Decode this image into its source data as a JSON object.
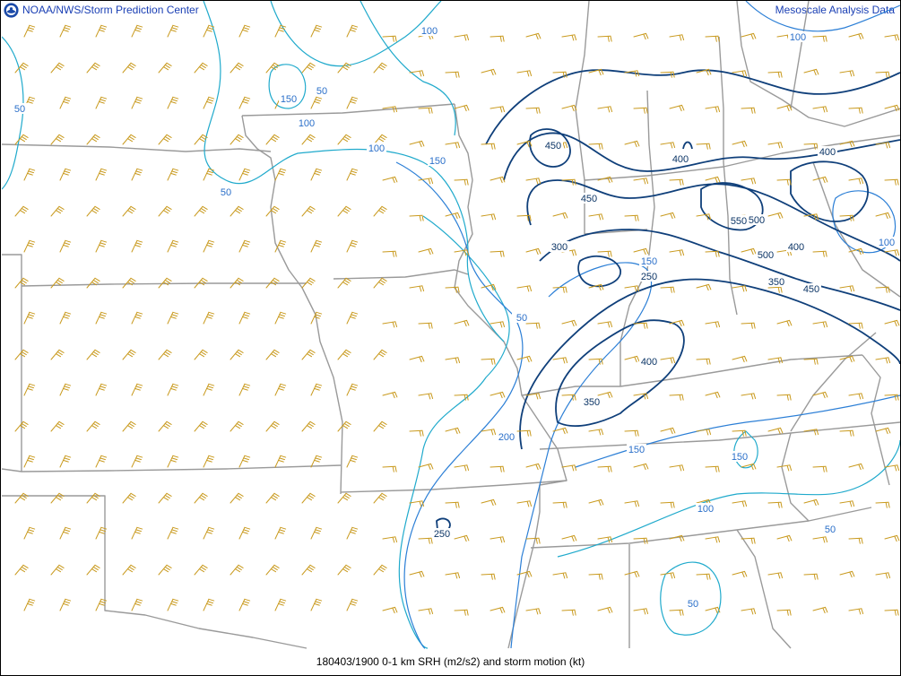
{
  "header": {
    "agency": "NOAA/NWS/Storm Prediction Center",
    "product": "Mesoscale Analysis Data"
  },
  "footer": {
    "caption": "180403/1900 0-1 km SRH (m2/s2) and storm motion (kt)"
  },
  "colors": {
    "boundary": "#9a9a9a",
    "barb": "#c99a1e",
    "contour_low": "#20aacc",
    "contour_mid": "#2c7fd6",
    "contour_high": "#0f3f7a",
    "label_text": "#2a6fc9",
    "label_dark": "#0c3566"
  },
  "contour_labels": [
    {
      "text": "100",
      "level": "low"
    },
    {
      "text": "50",
      "level": "low"
    },
    {
      "text": "150",
      "level": "low"
    },
    {
      "text": "50",
      "level": "low"
    },
    {
      "text": "100",
      "level": "low"
    },
    {
      "text": "50",
      "level": "low"
    },
    {
      "text": "100",
      "level": "low"
    },
    {
      "text": "150",
      "level": "mid"
    },
    {
      "text": "50",
      "level": "low"
    },
    {
      "text": "150",
      "level": "mid"
    },
    {
      "text": "250",
      "level": "dark"
    },
    {
      "text": "300",
      "level": "dark"
    },
    {
      "text": "450",
      "level": "dark"
    },
    {
      "text": "450",
      "level": "dark"
    },
    {
      "text": "400",
      "level": "dark"
    },
    {
      "text": "550",
      "level": "dark"
    },
    {
      "text": "500",
      "level": "dark"
    },
    {
      "text": "500",
      "level": "dark"
    },
    {
      "text": "350",
      "level": "dark"
    },
    {
      "text": "450",
      "level": "dark"
    },
    {
      "text": "400",
      "level": "dark"
    },
    {
      "text": "400",
      "level": "dark"
    },
    {
      "text": "100",
      "level": "low"
    },
    {
      "text": "100",
      "level": "low"
    },
    {
      "text": "400",
      "level": "dark"
    },
    {
      "text": "350",
      "level": "dark"
    },
    {
      "text": "200",
      "level": "mid"
    },
    {
      "text": "150",
      "level": "mid"
    },
    {
      "text": "150",
      "level": "low"
    },
    {
      "text": "100",
      "level": "low"
    },
    {
      "text": "50",
      "level": "low"
    },
    {
      "text": "250",
      "level": "dark"
    },
    {
      "text": "50",
      "level": "low"
    }
  ]
}
